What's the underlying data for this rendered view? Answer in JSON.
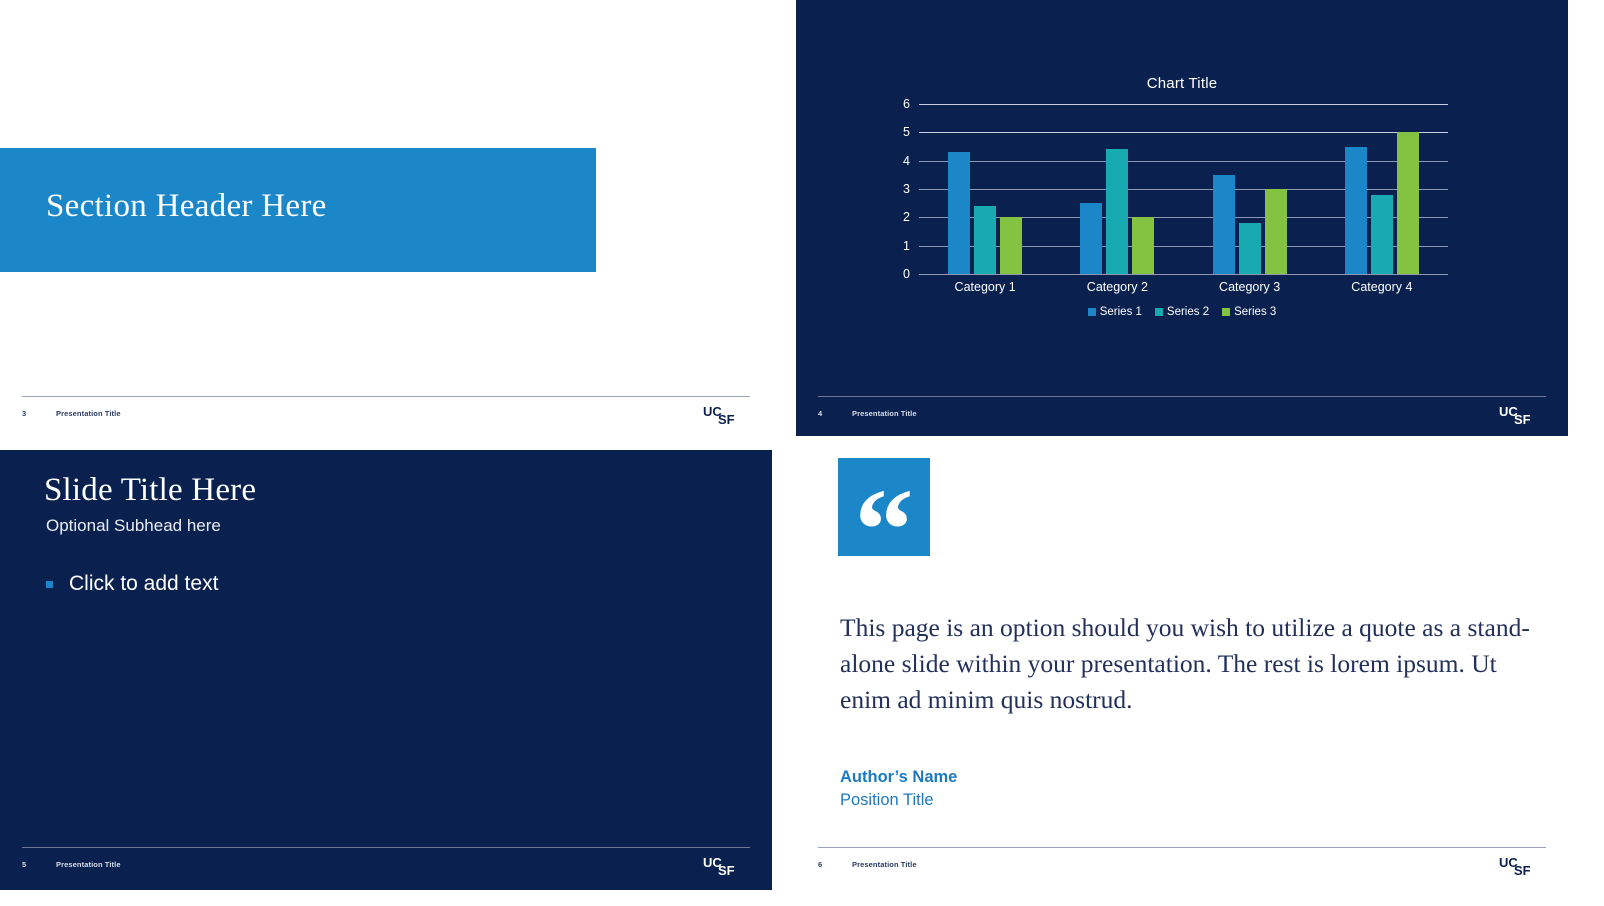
{
  "brand": {
    "accent_blue": "#1b87c9",
    "navy": "#0a2150",
    "teal": "#17aab0",
    "green": "#84c341",
    "logo_text": "UCSF"
  },
  "slides": [
    {
      "id": "section-header",
      "page_number": "3",
      "footer_title": "Presentation Title",
      "band_title": "Section Header Here"
    },
    {
      "id": "chart-slide",
      "page_number": "4",
      "footer_title": "Presentation Title"
    },
    {
      "id": "title-body",
      "page_number": "5",
      "footer_title": "Presentation Title",
      "title": "Slide Title Here",
      "subhead": "Optional Subhead here",
      "bullet": "Click to add text"
    },
    {
      "id": "quote-slide",
      "page_number": "6",
      "footer_title": "Presentation Title",
      "quote_glyph": "“",
      "quote": "This page is an option should you wish to utilize a quote as a stand-alone slide within your presentation. The rest is lorem ipsum. Ut enim ad minim quis nostrud.",
      "author": "Author’s Name",
      "position": "Position Title"
    }
  ],
  "chart_data": {
    "type": "bar",
    "title": "Chart Title",
    "xlabel": "",
    "ylabel": "",
    "categories": [
      "Category 1",
      "Category 2",
      "Category 3",
      "Category 4"
    ],
    "series": [
      {
        "name": "Series 1",
        "color": "#1b87c9",
        "values": [
          4.3,
          2.5,
          3.5,
          4.5
        ]
      },
      {
        "name": "Series 2",
        "color": "#17aab0",
        "values": [
          2.4,
          4.4,
          1.8,
          2.8
        ]
      },
      {
        "name": "Series 3",
        "color": "#84c341",
        "values": [
          2.0,
          2.0,
          3.0,
          5.0
        ]
      }
    ],
    "ylim": [
      0,
      6
    ],
    "yticks": [
      0,
      1,
      2,
      3,
      4,
      5,
      6
    ],
    "grid": true,
    "legend_position": "bottom"
  }
}
